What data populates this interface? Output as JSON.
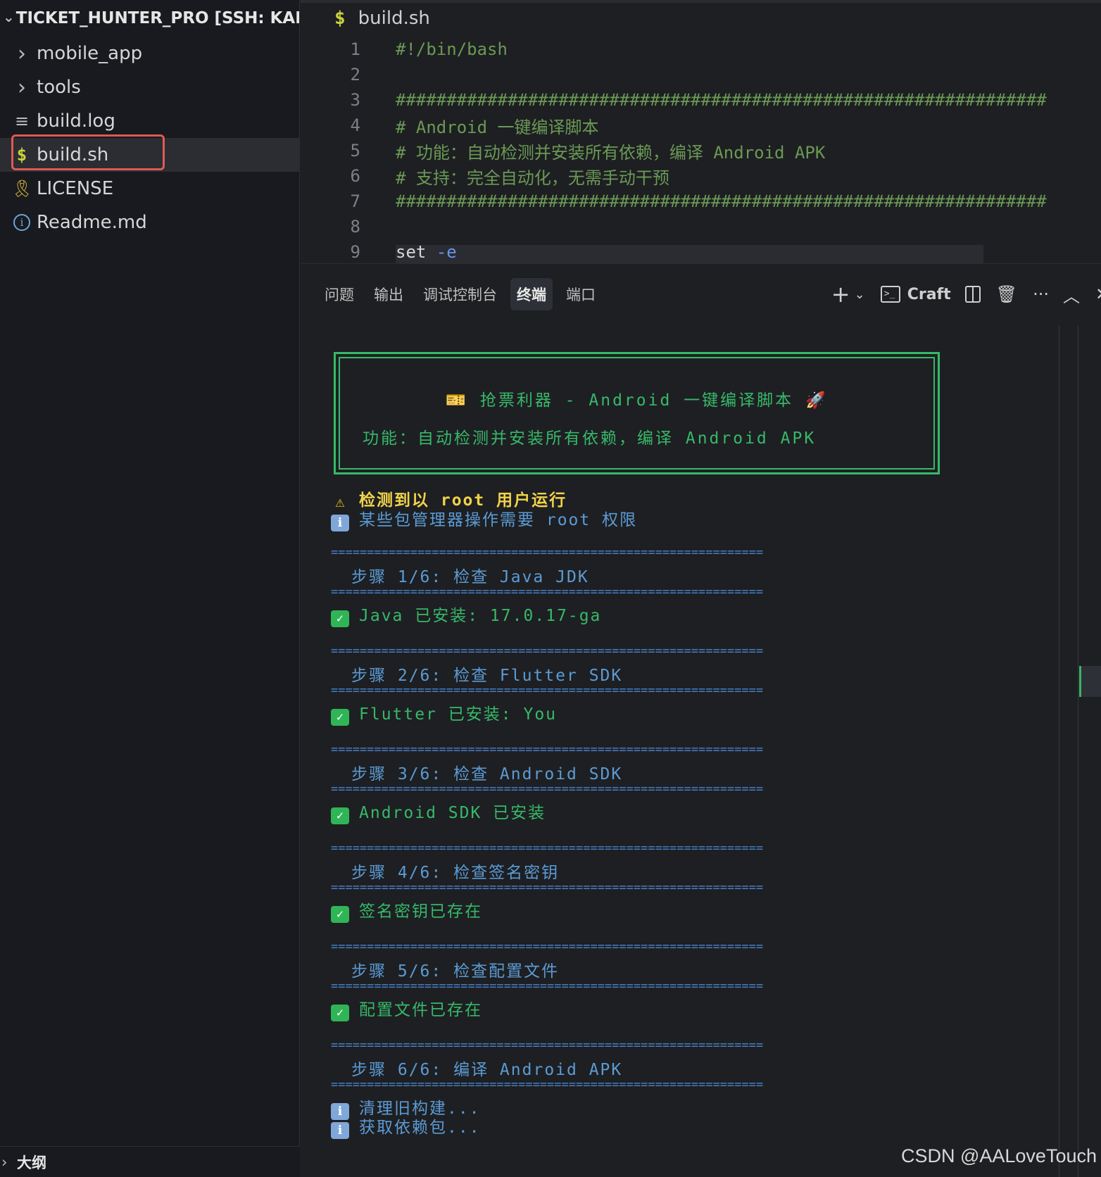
{
  "sidebar": {
    "root_label": "TICKET_HUNTER_PRO [SSH: KAIF...",
    "items": [
      {
        "label": "mobile_app",
        "icon": "chevron-right-icon",
        "glyph": "›"
      },
      {
        "label": "tools",
        "icon": "chevron-right-icon",
        "glyph": "›"
      },
      {
        "label": "build.log",
        "icon": "lines-icon",
        "glyph": "≡"
      },
      {
        "label": "build.sh",
        "icon": "dollar-icon",
        "glyph": "$"
      },
      {
        "label": "LICENSE",
        "icon": "license-icon",
        "glyph": "🎗"
      },
      {
        "label": "Readme.md",
        "icon": "info-icon",
        "glyph": "i"
      }
    ],
    "outline_label": "大纲"
  },
  "editor": {
    "filename": "build.sh",
    "lines": [
      {
        "n": "1",
        "text": "#!/bin/bash"
      },
      {
        "n": "2",
        "text": ""
      },
      {
        "n": "3",
        "text": "################################################################"
      },
      {
        "n": "4",
        "text": "# Android 一键编译脚本"
      },
      {
        "n": "5",
        "text": "# 功能：自动检测并安装所有依赖，编译 Android APK"
      },
      {
        "n": "6",
        "text": "# 支持：完全自动化，无需手动干预"
      },
      {
        "n": "7",
        "text": "################################################################"
      },
      {
        "n": "8",
        "text": ""
      },
      {
        "n": "9",
        "kw": "set",
        "flag": "-e"
      }
    ]
  },
  "panel": {
    "tabs": [
      "问题",
      "输出",
      "调试控制台",
      "终端",
      "端口"
    ],
    "active_tab": "终端",
    "craft_label": "Craft"
  },
  "terminal": {
    "banner_title": "🎫 抢票利器 - Android 一键编译脚本 🚀",
    "banner_sub": "功能：自动检测并安装所有依赖，编译 Android APK",
    "root_warning": "检测到以 root 用户运行",
    "root_info": "某些包管理器操作需要 root 权限",
    "separator": "============================================================",
    "steps": [
      {
        "title": "步骤 1/6: 检查 Java JDK",
        "result": "Java 已安装: 17.0.17-ga"
      },
      {
        "title": "步骤 2/6: 检查 Flutter SDK",
        "result": "Flutter 已安装: You"
      },
      {
        "title": "步骤 3/6: 检查 Android SDK",
        "result": "Android SDK 已安装"
      },
      {
        "title": "步骤 4/6: 检查签名密钥",
        "result": "签名密钥已存在"
      },
      {
        "title": "步骤 5/6: 检查配置文件",
        "result": "配置文件已存在"
      },
      {
        "title": "步骤 6/6: 编译 Android APK"
      }
    ],
    "final_info": [
      "清理旧构建...",
      "获取依赖包..."
    ]
  },
  "watermark": "CSDN @AALoveTouch",
  "colors": {
    "accent_green": "#36b96a",
    "warning_yellow": "#f0d34a",
    "info_blue": "#5b9bd5",
    "selection_red": "#e05a52"
  }
}
